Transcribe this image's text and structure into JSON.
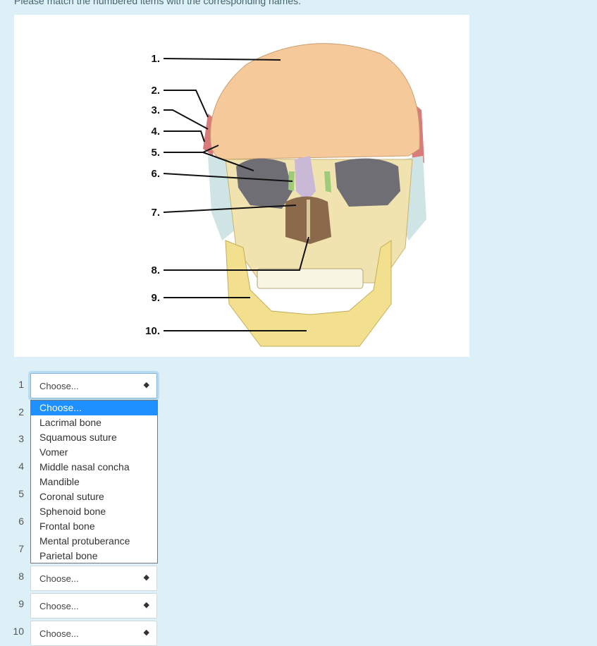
{
  "instructions": "Please match the numbered items with the corresponding names.",
  "figure": {
    "callouts": [
      "1.",
      "2.",
      "3.",
      "4.",
      "5.",
      "6.",
      "7.",
      "8.",
      "9.",
      "10."
    ]
  },
  "questions": [
    {
      "num": "1",
      "value": "Choose..."
    },
    {
      "num": "2"
    },
    {
      "num": "3"
    },
    {
      "num": "4"
    },
    {
      "num": "5"
    },
    {
      "num": "6"
    },
    {
      "num": "7"
    },
    {
      "num": "8",
      "value": "Choose..."
    },
    {
      "num": "9",
      "value": "Choose..."
    },
    {
      "num": "10",
      "value": "Choose..."
    }
  ],
  "dropdown": {
    "options": [
      "Choose...",
      "Lacrimal bone",
      "Squamous suture",
      "Vomer",
      "Middle nasal concha",
      "Mandible",
      "Coronal suture",
      "Sphenoid bone",
      "Frontal bone",
      "Mental protuberance",
      "Parietal bone"
    ],
    "highlighted_index": 0
  },
  "colors": {
    "background": "#def0f7",
    "highlight": "#1e90ff",
    "frontal": "#f5c99a",
    "parietal": "#d97b7b",
    "zygomatic": "#cfe4e4",
    "maxilla": "#f0e3b0",
    "mandible": "#f3e08e",
    "nasal": "#c9b8d6",
    "sphenoid": "#6e6e74"
  }
}
